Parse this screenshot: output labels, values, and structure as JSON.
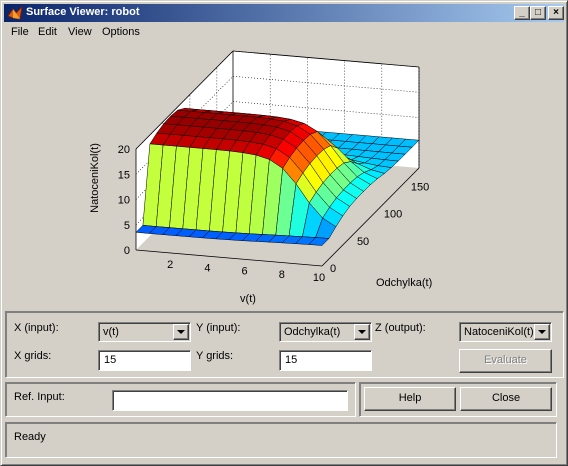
{
  "window": {
    "title": "Surface Viewer: robot"
  },
  "titlebar_buttons": {
    "minimize": "_",
    "maximize": "□",
    "close": "×"
  },
  "menu": [
    "File",
    "Edit",
    "View",
    "Options"
  ],
  "chart_data": {
    "type": "surface",
    "xlabel": "v(t)",
    "ylabel": "Odchylka(t)",
    "zlabel": "NatoceniKol(t)",
    "xlim": [
      0,
      10
    ],
    "ylim": [
      0,
      180
    ],
    "zlim": [
      0,
      20
    ],
    "x_ticks": [
      "2",
      "4",
      "6",
      "8",
      "10"
    ],
    "y_ticks": [
      "0",
      "50",
      "100",
      "150"
    ],
    "z_ticks": [
      "0",
      "5",
      "10",
      "15",
      "20"
    ],
    "grid": "on",
    "colormap": "jet",
    "grid_points": 15
  },
  "controls": {
    "x_input_label": "X (input):",
    "x_input_value": "v(t)",
    "y_input_label": "Y (input):",
    "y_input_value": "Odchylka(t)",
    "z_output_label": "Z (output):",
    "z_output_value": "NatoceniKol(t)",
    "x_grids_label": "X grids:",
    "x_grids_value": "15",
    "y_grids_label": "Y grids:",
    "y_grids_value": "15",
    "evaluate_label": "Evaluate",
    "ref_input_label": "Ref. Input:",
    "ref_input_value": "",
    "help_label": "Help",
    "close_label": "Close",
    "status_text": "Ready"
  },
  "colors": {
    "titlebar_start": "#0a246a",
    "titlebar_end": "#a6caf0",
    "face": "#d4d0c8"
  }
}
